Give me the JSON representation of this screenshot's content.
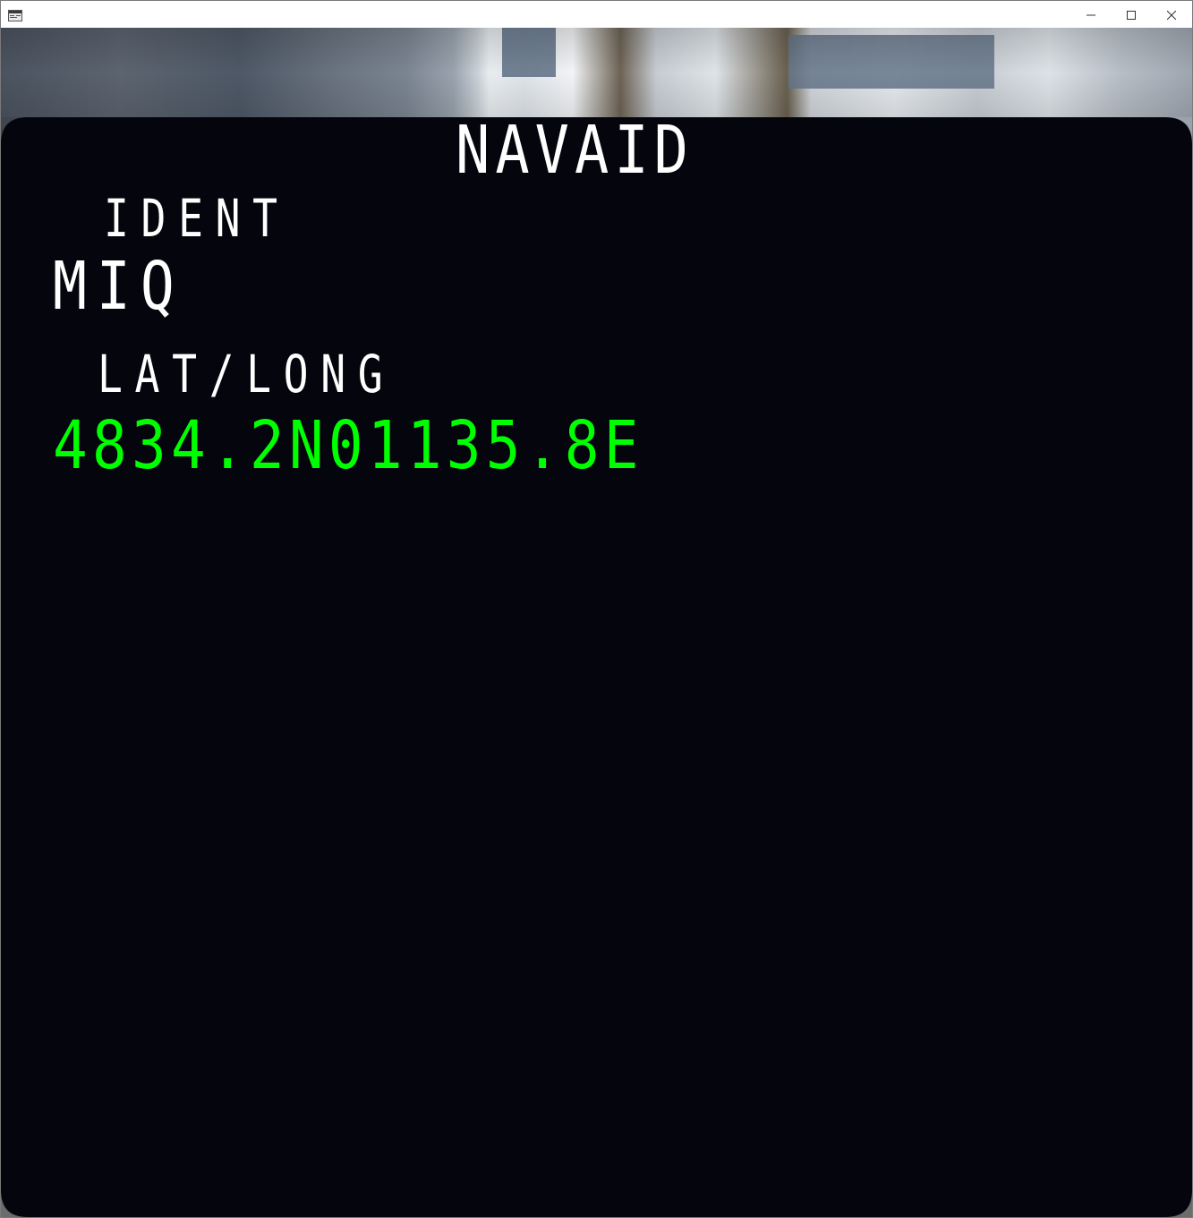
{
  "window": {
    "title": "",
    "icon": "app-window-icon",
    "controls": [
      "minimize-icon",
      "maximize-icon",
      "close-icon"
    ]
  },
  "mcdu": {
    "page_title": "NAVAID",
    "ident_label": "IDENT",
    "ident_value": "MIQ",
    "latlong_label": "LAT/LONG",
    "latlong_value": "4834.2N01135.8E"
  },
  "colors": {
    "screen_background": "#05050e",
    "label_text": "#ffffff",
    "data_text_green": "#00ff00"
  }
}
